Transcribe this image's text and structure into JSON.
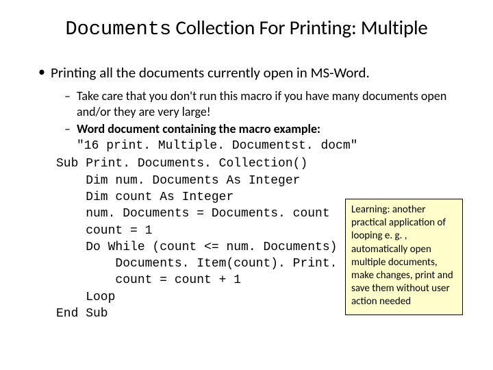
{
  "title": {
    "mono": "Documents",
    "rest": " Collection For Printing: Multiple"
  },
  "bullet1": "Printing all the documents currently open in MS-Word.",
  "sub1": "Take care that you don't run this macro if you have many documents open and/or they are very large!",
  "sub2": "Word document containing the macro example:",
  "filename": "\"16 print. Multiple. Documentst. docm\"",
  "code": "Sub Print. Documents. Collection()\n    Dim num. Documents As Integer\n    Dim count As Integer\n    num. Documents = Documents. count\n    count = 1\n    Do While (count <= num. Documents)\n        Documents. Item(count). Print. Out\n        count = count + 1\n    Loop\nEnd Sub",
  "note": "Learning: another practical application of looping e. g. , automatically open multiple documents, make changes, print and save them without user action needed"
}
